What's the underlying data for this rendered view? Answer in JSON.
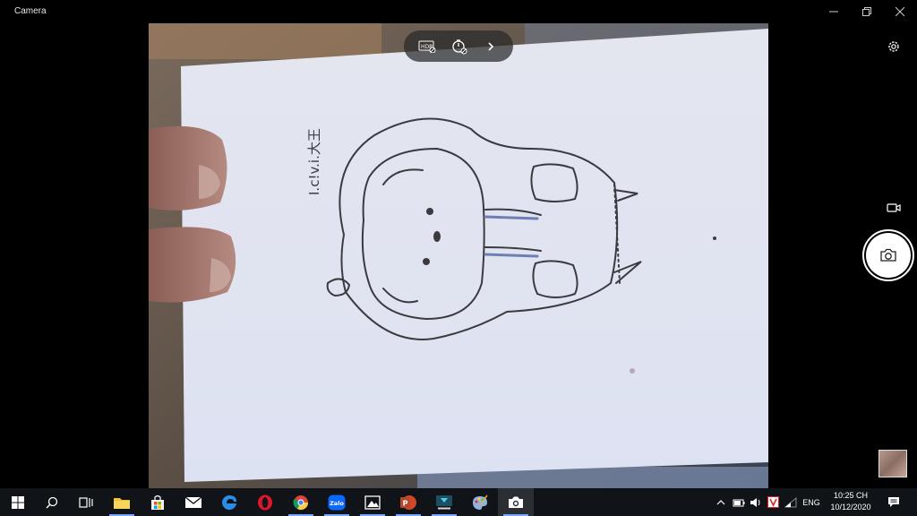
{
  "window": {
    "title": "Camera"
  },
  "icons": {
    "minimize": "minimize-icon",
    "restore": "restore-icon",
    "close": "close-icon",
    "hdr": "hdr-off-icon",
    "timer": "timer-off-icon",
    "more": "chevron-right-icon",
    "settings": "gear-icon",
    "video": "video-camera-icon",
    "shutter": "camera-icon"
  },
  "viewfinder": {
    "drawing_text": "I.c!v.i.大王"
  },
  "taskbar": {
    "apps": [
      "start",
      "search",
      "task-view",
      "file-explorer",
      "microsoft-store",
      "mail",
      "edge",
      "opera",
      "chrome",
      "zalo",
      "photos",
      "powerpoint",
      "app-download",
      "paint",
      "camera"
    ],
    "zalo_label": "Zalo",
    "powerpoint_label": "P",
    "tray": {
      "language": "ENG",
      "time": "10:25 CH",
      "date": "10/12/2020"
    }
  },
  "colors": {
    "taskbar_bg": "#101418",
    "active_indicator": "#7aa7ff",
    "paper": "#e7eaf4"
  }
}
